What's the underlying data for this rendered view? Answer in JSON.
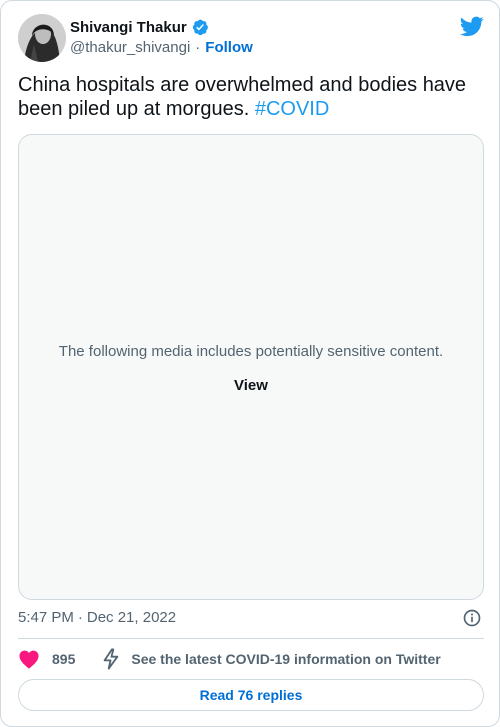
{
  "author": {
    "display_name": "Shivangi Thakur",
    "handle": "@thakur_shivangi",
    "separator": "·",
    "follow_label": "Follow",
    "verified": true
  },
  "tweet": {
    "text": "China hospitals are overwhelmed and bodies have been piled up at morgues.",
    "hashtag": "#COVID"
  },
  "media": {
    "warning": "The following media includes potentially sensitive content.",
    "view_label": "View"
  },
  "meta": {
    "time": "5:47 PM",
    "separator": "·",
    "date": "Dec 21, 2022"
  },
  "actions": {
    "like_count": "895",
    "covid_info": "See the latest COVID-19 information on Twitter"
  },
  "replies": {
    "label": "Read 76 replies"
  },
  "icons": {
    "twitter": "twitter-bird-icon",
    "verified": "verified-badge-icon",
    "info": "info-icon",
    "heart": "heart-icon",
    "bolt": "lightning-icon"
  },
  "colors": {
    "brand_blue": "#1d9bf0",
    "link_blue": "#006fd6",
    "heart_pink": "#f91880",
    "secondary_text": "#536471",
    "border": "#cfd9de"
  }
}
